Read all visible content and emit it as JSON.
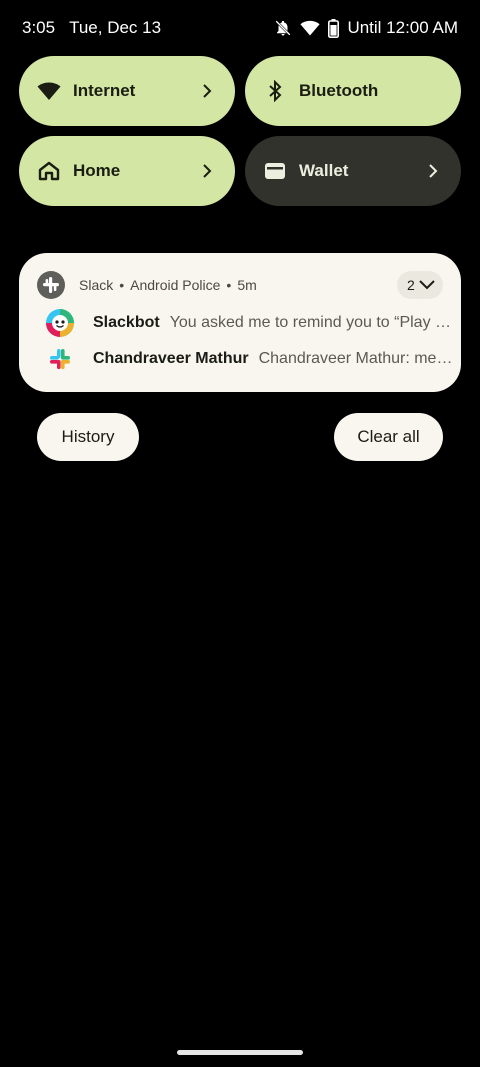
{
  "status_bar": {
    "time": "3:05",
    "date": "Tue, Dec 13",
    "alarm_text": "Until 12:00 AM",
    "icons": [
      "bell-off-icon",
      "wifi-icon",
      "battery-icon"
    ]
  },
  "quick_tiles": [
    {
      "label": "Internet",
      "icon": "wifi-icon",
      "state": "on",
      "has_chevron": true
    },
    {
      "label": "Bluetooth",
      "icon": "bluetooth-icon",
      "state": "on",
      "has_chevron": false
    },
    {
      "label": "Home",
      "icon": "home-icon",
      "state": "on",
      "has_chevron": true
    },
    {
      "label": "Wallet",
      "icon": "wallet-icon",
      "state": "off",
      "has_chevron": true
    }
  ],
  "notification": {
    "app": "Slack",
    "channel": "Android Police",
    "time": "5m",
    "count": "2",
    "separator": "•",
    "messages": [
      {
        "sender": "Slackbot",
        "text": "You asked me to remind you to “Play Dumb Ways to Die”.",
        "avatar": "slackbot-avatar"
      },
      {
        "sender": "Chandraveer Mathur",
        "text": "Chandraveer Mathur: message",
        "avatar": "slack-logo-icon"
      }
    ]
  },
  "actions": {
    "history_label": "History",
    "clear_all_label": "Clear all"
  },
  "colors": {
    "tile_on": "#d3e6a3",
    "tile_off": "#31322b",
    "card_bg": "#f8f6ee",
    "background": "#000000"
  }
}
